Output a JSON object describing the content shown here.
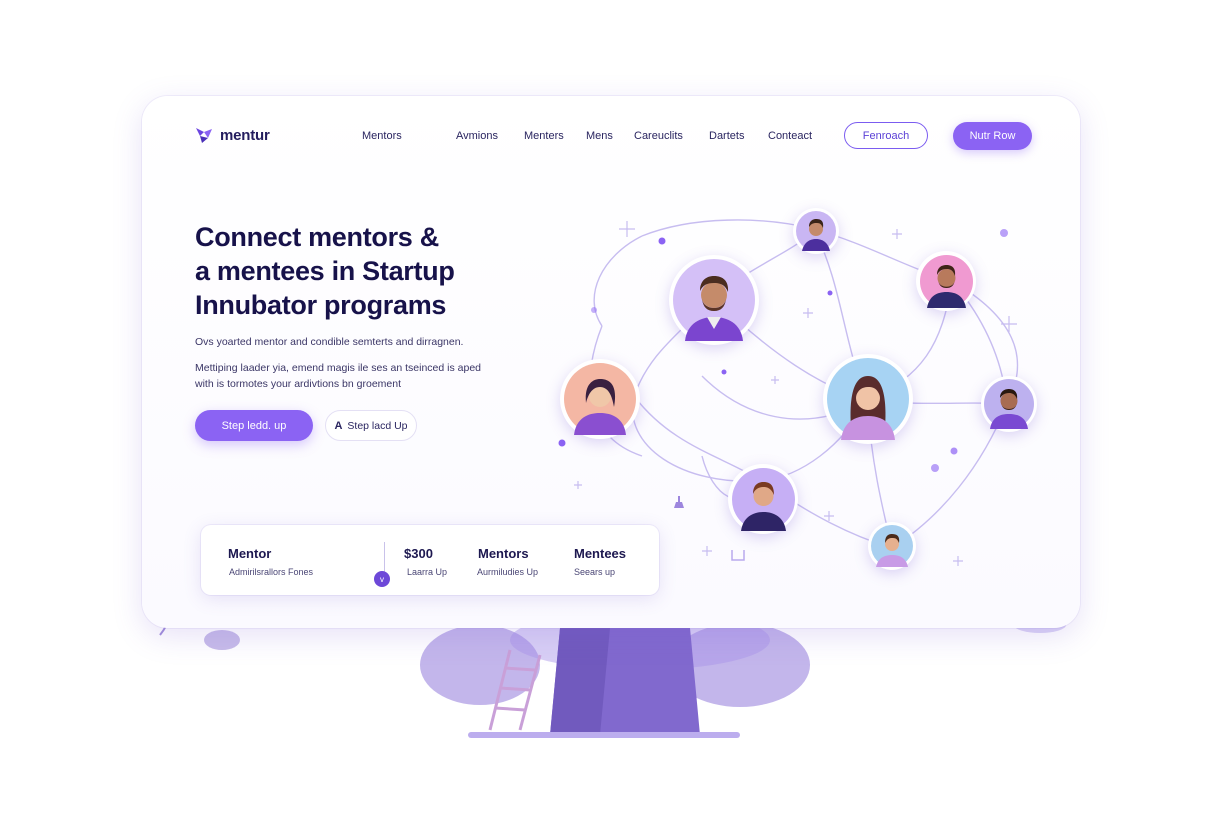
{
  "brand": {
    "name": "mentur"
  },
  "nav": {
    "items": [
      "Mentors",
      "Avmions",
      "Menters",
      "Mens",
      "Careuclits",
      "Dartets",
      "Conteact"
    ]
  },
  "header": {
    "outline_button": "Fenroach",
    "filled_button": "Nutr Row"
  },
  "hero": {
    "headline_lines": [
      "Connect mentors &",
      "a mentees in Startup",
      "Innubator programs"
    ],
    "subtitle": "Ovs yoarted mentor and condible semterts and dirragnen.",
    "body_lines": [
      "Mettiping laader yia, emend magis ile ses an tseinced is aped",
      "with is tormotes your ardivtions bn groement"
    ],
    "cta_primary": "Step ledd. up",
    "cta_secondary_icon": "A",
    "cta_secondary": "Step lacd Up"
  },
  "stats": {
    "items": [
      {
        "title": "Mentor",
        "sub": "Admirilsrallors Fones"
      },
      {
        "title": "$300",
        "sub": "Laarra Up"
      },
      {
        "title": "Mentors",
        "sub": "Aurmiludies Up"
      },
      {
        "title": "Mentees",
        "sub": "Seears up"
      }
    ],
    "chip": "v"
  },
  "colors": {
    "accent": "#8b63f3",
    "accent_dark": "#5a3fd6",
    "headline": "#17124a",
    "line": "#c7bdf0"
  },
  "icons": [
    "logo-icon",
    "avatar-icon",
    "sparkle-icon",
    "leaf-icon"
  ]
}
